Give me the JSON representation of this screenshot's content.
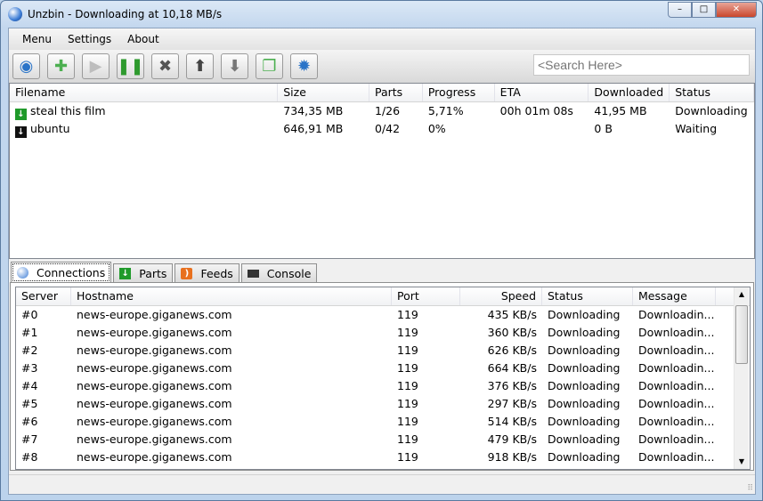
{
  "window": {
    "title": "Unzbin - Downloading at 10,18 MB/s",
    "min": "–",
    "max": "□",
    "close": "✕"
  },
  "menu": [
    "Menu",
    "Settings",
    "About"
  ],
  "toolbar": {
    "buttons": [
      {
        "name": "refresh",
        "glyph": "◉",
        "color": "#2a74c8"
      },
      {
        "name": "add-nzb",
        "glyph": "✚",
        "color": "#4caf50"
      },
      {
        "name": "start",
        "glyph": "▶",
        "color": "#bdbdbd"
      },
      {
        "name": "pause",
        "glyph": "❚❚",
        "color": "#2e9a2e"
      },
      {
        "name": "remove",
        "glyph": "✖",
        "color": "#555555"
      },
      {
        "name": "move-up",
        "glyph": "⬆",
        "color": "#444444"
      },
      {
        "name": "move-down",
        "glyph": "⬇",
        "color": "#777777"
      },
      {
        "name": "open-folder",
        "glyph": "❐",
        "color": "#4caf50"
      },
      {
        "name": "settings",
        "glyph": "✹",
        "color": "#2a74c8"
      }
    ],
    "search_placeholder": "<Search Here>"
  },
  "downloads": {
    "columns": [
      "Filename",
      "Size",
      "Parts",
      "Progress",
      "ETA",
      "Downloaded",
      "Status"
    ],
    "rows": [
      {
        "icon": "green-arrow",
        "name": "steal this film",
        "size": "734,35 MB",
        "parts": "1/26",
        "progress": "5,71%",
        "eta": "00h 01m 08s",
        "downloaded": "41,95 MB",
        "status": "Downloading"
      },
      {
        "icon": "black-arrow",
        "name": "ubuntu",
        "size": "646,91 MB",
        "parts": "0/42",
        "progress": "0%",
        "eta": "",
        "downloaded": "0 B",
        "status": "Waiting"
      }
    ]
  },
  "tabs": [
    "Connections",
    "Parts",
    "Feeds",
    "Console"
  ],
  "connections": {
    "columns": [
      "Server",
      "Hostname",
      "Port",
      "Speed",
      "Status",
      "Message"
    ],
    "rows": [
      [
        "#0",
        "news-europe.giganews.com",
        "119",
        "435 KB/s",
        "Downloading",
        "Downloadin..."
      ],
      [
        "#1",
        "news-europe.giganews.com",
        "119",
        "360 KB/s",
        "Downloading",
        "Downloadin..."
      ],
      [
        "#2",
        "news-europe.giganews.com",
        "119",
        "626 KB/s",
        "Downloading",
        "Downloadin..."
      ],
      [
        "#3",
        "news-europe.giganews.com",
        "119",
        "664 KB/s",
        "Downloading",
        "Downloadin..."
      ],
      [
        "#4",
        "news-europe.giganews.com",
        "119",
        "376 KB/s",
        "Downloading",
        "Downloadin..."
      ],
      [
        "#5",
        "news-europe.giganews.com",
        "119",
        "297 KB/s",
        "Downloading",
        "Downloadin..."
      ],
      [
        "#6",
        "news-europe.giganews.com",
        "119",
        "514 KB/s",
        "Downloading",
        "Downloadin..."
      ],
      [
        "#7",
        "news-europe.giganews.com",
        "119",
        "479 KB/s",
        "Downloading",
        "Downloadin..."
      ],
      [
        "#8",
        "news-europe.giganews.com",
        "119",
        "918 KB/s",
        "Downloading",
        "Downloadin..."
      ]
    ]
  }
}
